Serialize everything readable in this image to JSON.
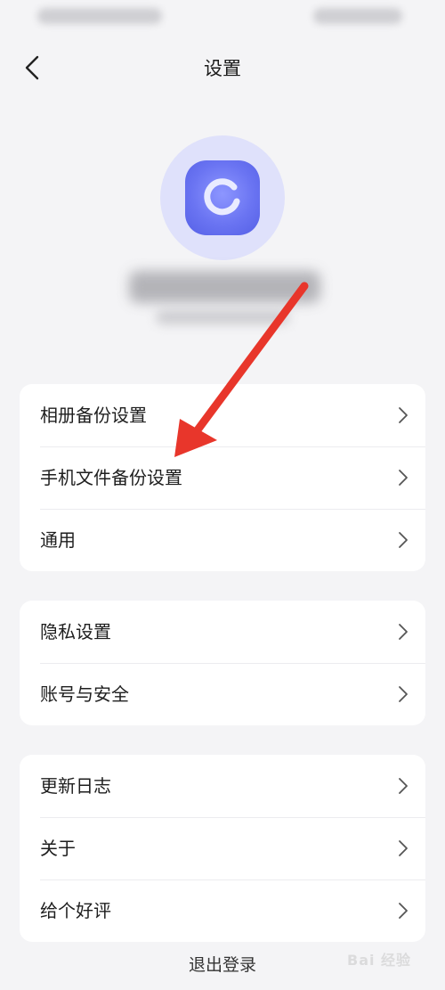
{
  "nav": {
    "title": "设置"
  },
  "sections": [
    {
      "items": [
        {
          "label": "相册备份设置"
        },
        {
          "label": "手机文件备份设置"
        },
        {
          "label": "通用"
        }
      ]
    },
    {
      "items": [
        {
          "label": "隐私设置"
        },
        {
          "label": "账号与安全"
        }
      ]
    },
    {
      "items": [
        {
          "label": "更新日志"
        },
        {
          "label": "关于"
        },
        {
          "label": "给个好评"
        }
      ]
    }
  ],
  "footer": {
    "logout_label": "退出登录"
  },
  "watermark": {
    "text": "Bai 经验"
  },
  "colors": {
    "accent": "#6a74f2",
    "arrow": "#e8362b",
    "background": "#f4f4f6"
  }
}
